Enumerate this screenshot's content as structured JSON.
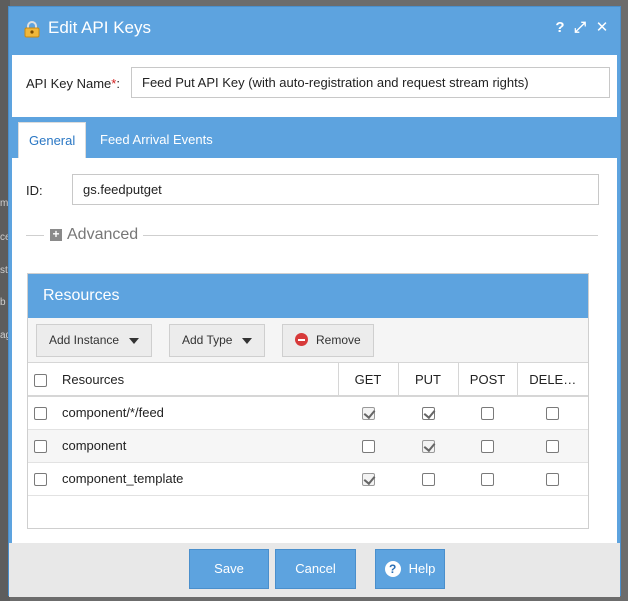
{
  "background": {
    "letters": [
      "m",
      "ce",
      "st",
      "b",
      "ag"
    ]
  },
  "dialog": {
    "title": "Edit API Keys",
    "controls": {
      "help": "?",
      "maximize": "⤢",
      "close": "✕"
    }
  },
  "key_name": {
    "label": "API Key Name",
    "required_mark": "*",
    "colon": ":",
    "value": "Feed Put API Key (with auto-registration and request stream rights)"
  },
  "tabs": [
    {
      "label": "General",
      "active": true
    },
    {
      "label": "Feed Arrival Events",
      "active": false
    }
  ],
  "general": {
    "id_label": "ID:",
    "id_value": "gs.feedputget",
    "advanced_label": "Advanced"
  },
  "resources": {
    "title": "Resources",
    "toolbar": {
      "add_instance": "Add Instance",
      "add_type": "Add Type",
      "remove": "Remove"
    },
    "columns": [
      "Resources",
      "GET",
      "PUT",
      "POST",
      "DELE…"
    ],
    "rows": [
      {
        "name": "component/*/feed",
        "get": true,
        "put": true,
        "post": false,
        "delete": false
      },
      {
        "name": "component",
        "get": false,
        "put": true,
        "post": false,
        "delete": false
      },
      {
        "name": "component_template",
        "get": true,
        "put": false,
        "post": false,
        "delete": false
      }
    ]
  },
  "footer": {
    "save": "Save",
    "cancel": "Cancel",
    "help": "Help"
  },
  "colors": {
    "accent": "#5da3df",
    "tab_active_text": "#2a77c4",
    "required": "#d01c1c"
  }
}
